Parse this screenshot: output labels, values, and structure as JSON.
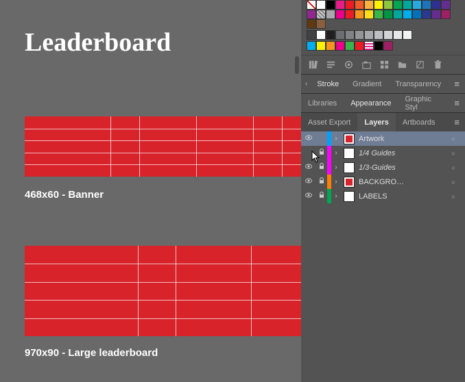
{
  "document": {
    "title": "Leaderboard"
  },
  "artboards": [
    {
      "label": "468x60 - Banner"
    },
    {
      "label": "970x90 - Large leaderboard"
    }
  ],
  "panel_tabs": {
    "stroke": "Stroke",
    "gradient": "Gradient",
    "transparency": "Transparency",
    "libraries": "Libraries",
    "appearance": "Appearance",
    "graphic_styles": "Graphic Styl",
    "asset_export": "Asset Export",
    "layers": "Layers",
    "artboards_tab": "Artboards"
  },
  "swatches": [
    "none",
    "#ffffff",
    "#000000",
    "#e71b8a",
    "#ed1c24",
    "#f15a29",
    "#fbb040",
    "#fff200",
    "#8dc63f",
    "#00a651",
    "#00a99d",
    "#27aae1",
    "#1c75bc",
    "#2e3192",
    "#662d91",
    "#92278f",
    "pattern",
    "#a7a9ac",
    "#ec008c",
    "#ed1c24",
    "#f7941d",
    "#ffde17",
    "#39b54a",
    "#009444",
    "#00a79d",
    "#00aeef",
    "#0072bc",
    "#2b3990",
    "#662d91",
    "#9e1f63",
    "#603913",
    "#8b5e3c",
    "gap",
    "#414042",
    "#fff",
    "#231f20",
    "#6d6e71",
    "#808285",
    "#939598",
    "#a7a9ac",
    "#bcbec0",
    "#d1d3d4",
    "#e6e7e8",
    "#f1f2f2",
    "gap",
    "#00aeef",
    "#fff200",
    "#f7941d",
    "#ec008c",
    "#39b54a",
    "#ed1c24",
    "pattern2",
    "#000000",
    "#9e1f63"
  ],
  "layers": [
    {
      "name": "Artwork",
      "color": "#00a0ff",
      "visible": true,
      "locked": false,
      "selected": true,
      "thumb": "#d8232a",
      "italic": false
    },
    {
      "name": "1/4 Guides",
      "color": "#ff00ff",
      "visible": false,
      "locked": true,
      "selected": false,
      "thumb": "#ffffff",
      "italic": true
    },
    {
      "name": "1/3-Guides",
      "color": "#ff00ff",
      "visible": true,
      "locked": true,
      "selected": false,
      "thumb": "#ffffff",
      "italic": true
    },
    {
      "name": "BACKGRO…",
      "color": "#ff7f00",
      "visible": true,
      "locked": true,
      "selected": false,
      "thumb": "#d8232a",
      "italic": false
    },
    {
      "name": "LABELS",
      "color": "#00a651",
      "visible": true,
      "locked": true,
      "selected": false,
      "thumb": "#ffffff",
      "italic": false
    }
  ]
}
